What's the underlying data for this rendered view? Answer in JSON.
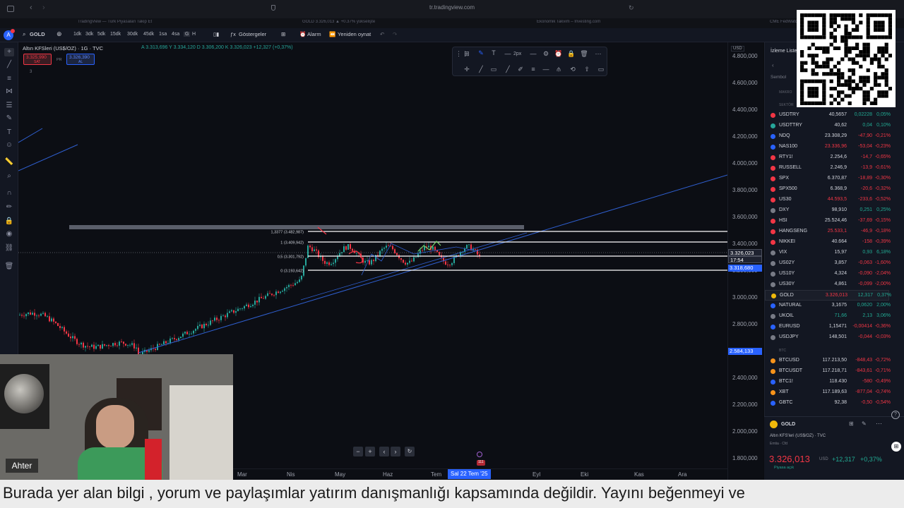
{
  "browser": {
    "url": "tr.tradingview.com",
    "tabs": [
      "TradingView — Türk Piyasaları Takip Et",
      "GOLD 3.326,013 ▲ +0.37% yükselişte",
      "Ekonomik Takvim – Investing.com",
      "CME FedWatch"
    ]
  },
  "toolbar": {
    "symbol": "GOLD",
    "timeframes": [
      "1dk",
      "3dk",
      "5dk",
      "15dk",
      "30dk",
      "45dk",
      "1sa",
      "4sa",
      "G",
      "H"
    ],
    "indicators_label": "Göstergeler",
    "alarm_label": "Alarm",
    "replay_label": "Yeniden oynat",
    "user_badge": "A"
  },
  "chart": {
    "title": "Altın KFSleri (US$/OZ) · 1G · TVC",
    "ohlc": "A 3.313,696  Y 3.334,120  D 3.306,200  K 3.326,023  +12,327 (+0,37%)",
    "sell_price": "3.325,990",
    "sell_label": "SAT",
    "buy_price": "3.326,390",
    "buy_label": "AL",
    "spread": "PR",
    "stroke_width": "2px",
    "currency": "USD",
    "indicator_count": "3",
    "y_axis": [
      "4.800,000",
      "4.600,000",
      "4.400,000",
      "4.200,000",
      "4.000,000",
      "3.800,000",
      "3.600,000",
      "3.400,000",
      "3.200,000",
      "3.000,000",
      "2.800,000",
      "2.600,000",
      "2.400,000",
      "2.200,000",
      "2.000,000",
      "1.800,000"
    ],
    "current_price": "3.326,023",
    "countdown": "17:54",
    "level_tag": "3.318,680",
    "low_tag": "2.584,133",
    "fib_levels": [
      {
        "label": "1,3377 (3.482,987)"
      },
      {
        "label": "1 (3.409,942)"
      },
      {
        "label": "0,5 (3.301,792)"
      },
      {
        "label": "0 (3.193,642)"
      }
    ],
    "time_axis": [
      "Mar",
      "Nis",
      "May",
      "Haz",
      "Tem",
      "Sal 22 Tem '25",
      "Eyl",
      "Eki",
      "Kas",
      "Ara"
    ],
    "events_badge": "111",
    "colors": {
      "up": "#26a69a",
      "down": "#f23645",
      "trend": "#2f5fd0",
      "fib": "#ffffff"
    }
  },
  "watchlist": {
    "title": "İzleme Listesi",
    "symbol_header": "Sembol",
    "section_macro": "MAKRO",
    "section_sector": "SEKTÖR",
    "section_btc": "BTC",
    "rows": [
      {
        "sym": "USDTRY",
        "last": "40,5657",
        "chg": "0,02228",
        "pct": "0,05%",
        "dir": "pos",
        "color": "#f23645"
      },
      {
        "sym": "USDTTRY",
        "last": "40,62",
        "chg": "0,04",
        "pct": "0,10%",
        "dir": "pos",
        "color": "#26a69a"
      },
      {
        "sym": "NDQ",
        "last": "23.308,29",
        "chg": "-47,90",
        "pct": "-0,21%",
        "dir": "neg",
        "color": "#2962ff"
      },
      {
        "sym": "NAS100",
        "last": "23.336,96",
        "chg": "-53,04",
        "pct": "-0,23%",
        "dir": "neg",
        "color": "#2962ff"
      },
      {
        "sym": "RTY1!",
        "last": "2.254,6",
        "chg": "-14,7",
        "pct": "-0,65%",
        "dir": "neg",
        "color": "#f23645"
      },
      {
        "sym": "RUSSELL",
        "last": "2.246,9",
        "chg": "-13,9",
        "pct": "-0,61%",
        "dir": "neg",
        "color": "#f23645"
      },
      {
        "sym": "SPX",
        "last": "6.370,87",
        "chg": "-18,89",
        "pct": "-0,30%",
        "dir": "neg",
        "color": "#f23645"
      },
      {
        "sym": "SPX500",
        "last": "6.368,9",
        "chg": "-20,6",
        "pct": "-0,32%",
        "dir": "neg",
        "color": "#f23645"
      },
      {
        "sym": "US30",
        "last": "44.593,5",
        "chg": "-233,6",
        "pct": "-0,52%",
        "dir": "neg",
        "color": "#f23645"
      },
      {
        "sym": "DXY",
        "last": "98,910",
        "chg": "0,251",
        "pct": "0,25%",
        "dir": "pos",
        "color": "#787b86"
      },
      {
        "sym": "HSI",
        "last": "25.524,46",
        "chg": "-37,69",
        "pct": "-0,15%",
        "dir": "neg",
        "color": "#f23645"
      },
      {
        "sym": "HANGSENG",
        "last": "25.533,1",
        "chg": "-46,9",
        "pct": "-0,18%",
        "dir": "neg",
        "color": "#f23645"
      },
      {
        "sym": "NIKKEI",
        "last": "40.664",
        "chg": "-158",
        "pct": "-0,39%",
        "dir": "neg",
        "color": "#f23645"
      },
      {
        "sym": "VIX",
        "last": "15,97",
        "chg": "0,93",
        "pct": "6,18%",
        "dir": "pos",
        "color": "#787b86"
      },
      {
        "sym": "US02Y",
        "last": "3,857",
        "chg": "-0,063",
        "pct": "-1,60%",
        "dir": "neg",
        "color": "#787b86"
      },
      {
        "sym": "US10Y",
        "last": "4,324",
        "chg": "-0,090",
        "pct": "-2,04%",
        "dir": "neg",
        "color": "#787b86"
      },
      {
        "sym": "US30Y",
        "last": "4,861",
        "chg": "-0,099",
        "pct": "-2,00%",
        "dir": "neg",
        "color": "#787b86"
      },
      {
        "sym": "GOLD",
        "last": "3.326,013",
        "chg": "12,317",
        "pct": "0,37%",
        "dir": "pos",
        "color": "#f0b90b",
        "active": true
      },
      {
        "sym": "NATURAL",
        "last": "3,1675",
        "chg": "0,0620",
        "pct": "2,00%",
        "dir": "pos",
        "color": "#2962ff"
      },
      {
        "sym": "UKOIL",
        "last": "71,66",
        "chg": "2,13",
        "pct": "3,06%",
        "dir": "pos",
        "color": "#787b86"
      },
      {
        "sym": "EURUSD",
        "last": "1,15471",
        "chg": "-0,00414",
        "pct": "-0,36%",
        "dir": "neg",
        "color": "#2962ff"
      },
      {
        "sym": "USDJPY",
        "last": "148,501",
        "chg": "-0,044",
        "pct": "-0,03%",
        "dir": "neg",
        "color": "#787b86"
      }
    ],
    "crypto_rows": [
      {
        "sym": "BTCUSD",
        "last": "117.213,50",
        "chg": "-848,43",
        "pct": "-0,72%",
        "dir": "neg",
        "color": "#f7931a"
      },
      {
        "sym": "BTCUSDT",
        "last": "117.218,71",
        "chg": "-843,61",
        "pct": "-0,71%",
        "dir": "neg",
        "color": "#f7931a"
      },
      {
        "sym": "BTC1!",
        "last": "118.430",
        "chg": "-580",
        "pct": "-0,49%",
        "dir": "neg",
        "color": "#2962ff"
      },
      {
        "sym": "XBT",
        "last": "117.189,63",
        "chg": "-877,04",
        "pct": "-0,74%",
        "dir": "neg",
        "color": "#f7931a"
      },
      {
        "sym": "GBTC",
        "last": "92,38",
        "chg": "-0,50",
        "pct": "-0,54%",
        "dir": "neg",
        "color": "#2962ff"
      }
    ]
  },
  "detail": {
    "symbol": "GOLD",
    "description": "Altın KFS'leri (US$/OZ) · TVC",
    "type": "Emtia · Cfd",
    "price": "3.326,013",
    "currency": "USD",
    "change": "+12,317",
    "change_pct": "+0,37%",
    "status": "Piyasa açık"
  },
  "webcam": {
    "name": "Ahter"
  },
  "disclaimer": "Burada yer alan bilgi , yorum ve paylaşımlar yatırım danışmanlığı kapsamında değildir. Yayını beğenmeyi ve"
}
